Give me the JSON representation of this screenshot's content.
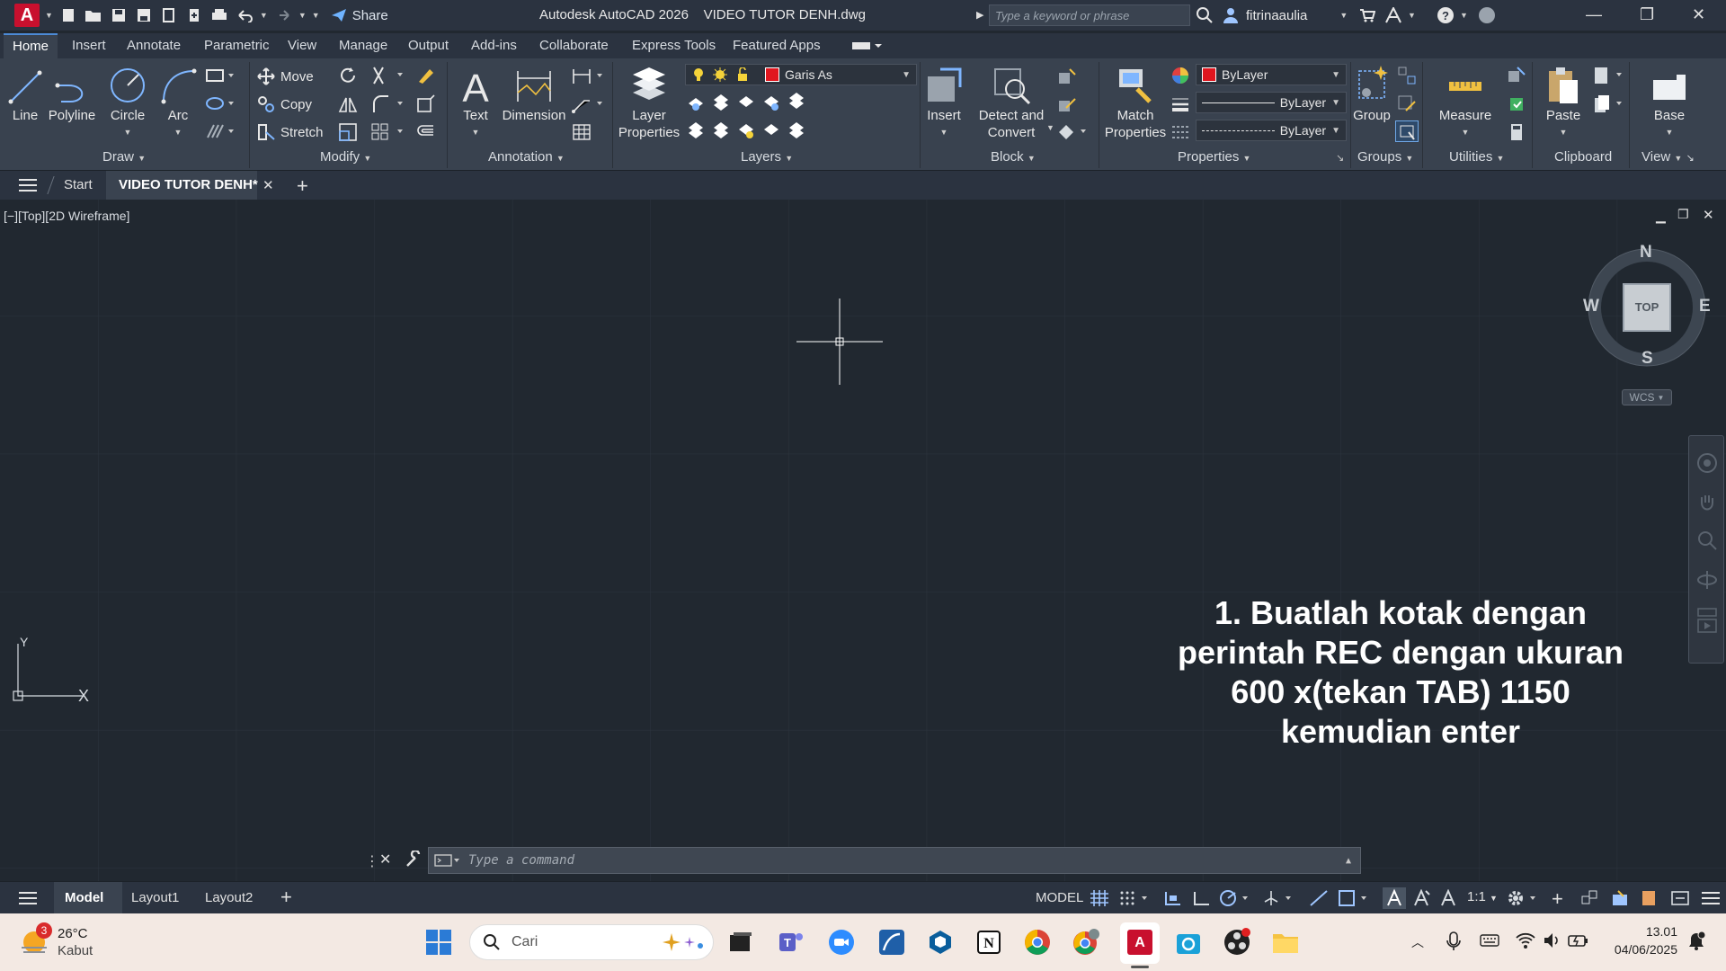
{
  "window": {
    "app_name": "Autodesk AutoCAD 2026",
    "file_name": "VIDEO TUTOR DENH.dwg",
    "share_label": "Share",
    "search_placeholder": "Type a keyword or phrase",
    "user_name": "fitrinaaulia"
  },
  "ribbon_tabs": [
    "Home",
    "Insert",
    "Annotate",
    "Parametric",
    "View",
    "Manage",
    "Output",
    "Add-ins",
    "Collaborate",
    "Express Tools",
    "Featured Apps"
  ],
  "ribbon": {
    "draw": {
      "label": "Draw",
      "line": "Line",
      "polyline": "Polyline",
      "circle": "Circle",
      "arc": "Arc"
    },
    "modify": {
      "label": "Modify",
      "move": "Move",
      "copy": "Copy",
      "stretch": "Stretch"
    },
    "annotation": {
      "label": "Annotation",
      "text": "Text",
      "dimension": "Dimension"
    },
    "layers": {
      "label": "Layers",
      "layer_properties": "Layer Properties",
      "current_layer": "Garis As"
    },
    "block": {
      "label": "Block",
      "insert": "Insert",
      "detect_convert": "Detect and Convert"
    },
    "properties": {
      "label": "Properties",
      "match": "Match Properties",
      "color": "ByLayer",
      "lineweight": "ByLayer",
      "linetype": "ByLayer"
    },
    "groups": {
      "label": "Groups",
      "group": "Group"
    },
    "utilities": {
      "label": "Utilities",
      "measure": "Measure"
    },
    "clipboard": {
      "label": "Clipboard",
      "paste": "Paste"
    },
    "view": {
      "label": "View",
      "base": "Base"
    }
  },
  "file_tabs": {
    "start": "Start",
    "active": "VIDEO TUTOR DENH*"
  },
  "viewport": {
    "label": "[−][Top][2D Wireframe]",
    "viewcube": {
      "n": "N",
      "s": "S",
      "e": "E",
      "w": "W",
      "top": "TOP",
      "wcs": "WCS"
    },
    "ucs_x": "X",
    "ucs_y": "Y",
    "instruction": [
      "1. Buatlah kotak dengan",
      "perintah REC dengan ukuran",
      "600 x(tekan TAB) 1150",
      "kemudian enter"
    ],
    "command_placeholder": "Type a command"
  },
  "status": {
    "model_tab": "Model",
    "layout1": "Layout1",
    "layout2": "Layout2",
    "model_label": "MODEL",
    "scale": "1:1"
  },
  "taskbar": {
    "weather_temp": "26°C",
    "weather_desc": "Kabut",
    "weather_badge": "3",
    "search_label": "Cari",
    "time": "13.01",
    "date": "04/06/2025"
  },
  "colors": {
    "canvas": "#212830",
    "ribbon": "#39424f",
    "accent": "#4c8ad6",
    "layer_red": "#e0161f"
  }
}
